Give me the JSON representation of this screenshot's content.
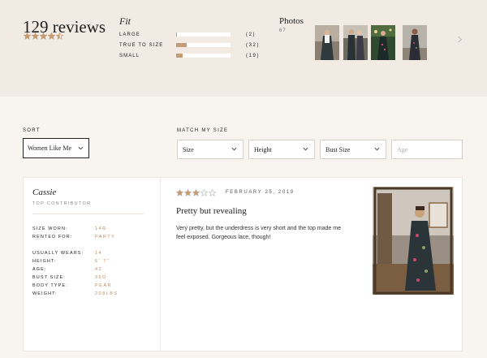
{
  "summary": {
    "review_count": "129 reviews",
    "rating_stars": 4.5,
    "fit": {
      "title": "Fit",
      "rows": [
        {
          "label": "LARGE",
          "count": "(2)",
          "fraction": 0.02
        },
        {
          "label": "TRUE TO SIZE",
          "count": "(32)",
          "fraction": 0.2
        },
        {
          "label": "SMALL",
          "count": "(19)",
          "fraction": 0.12
        }
      ]
    },
    "photos": {
      "title": "Photos",
      "count": "67"
    }
  },
  "filters": {
    "sort_label": "SORT",
    "sort_value": "Women Like Me",
    "match_label": "MATCH MY SIZE",
    "size": "Size",
    "height": "Height",
    "bust": "Bust Size",
    "age_placeholder": "Age"
  },
  "review": {
    "name": "Cassie",
    "role": "TOP CONTRIBUTOR",
    "attributes": [
      {
        "key": "SIZE WORN:",
        "value": "14R"
      },
      {
        "key": "RENTED FOR:",
        "value": "PARTY"
      },
      {
        "key": "USUALLY WEARS:",
        "value": "14"
      },
      {
        "key": "HEIGHT:",
        "value": "5' 7\""
      },
      {
        "key": "AGE:",
        "value": "42"
      },
      {
        "key": "BUST SIZE:",
        "value": "36D"
      },
      {
        "key": "BODY TYPE:",
        "value": "PEAR"
      },
      {
        "key": "WEIGHT:",
        "value": "208LBS"
      }
    ],
    "stars": 3,
    "date": "FEBRUARY 25, 2019",
    "title": "Pretty but revealing",
    "body": "Very pretty, but the underdress is very short and the top made me feel exposed. Gorgeous lace, though!"
  },
  "colors": {
    "star": "#c69c75",
    "accent": "#c08a5d",
    "summary_bg": "#f2ebe3"
  },
  "icons": {
    "star": "star-icon",
    "chevron": "chevron-down-icon",
    "arrow": "chevron-right-icon"
  }
}
